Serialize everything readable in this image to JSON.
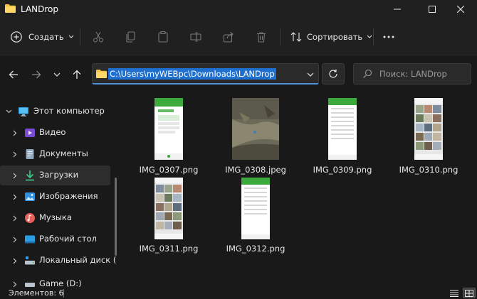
{
  "window": {
    "title": "LANDrop"
  },
  "toolbar": {
    "create_label": "Создать",
    "sort_label": "Сортировать",
    "icons": [
      "cut-icon",
      "copy-icon",
      "paste-icon",
      "rename-icon",
      "share-icon",
      "delete-icon"
    ]
  },
  "address": {
    "path": "C:\\Users\\myWEBpc\\Downloads\\LANDrop"
  },
  "search": {
    "placeholder": "Поиск: LANDrop"
  },
  "sidebar": {
    "items": [
      {
        "label": "Этот компьютер",
        "icon": "monitor-icon",
        "expanded": true
      },
      {
        "label": "Видео",
        "icon": "video-icon"
      },
      {
        "label": "Документы",
        "icon": "document-icon"
      },
      {
        "label": "Загрузки",
        "icon": "download-icon",
        "selected": true
      },
      {
        "label": "Изображения",
        "icon": "image-icon"
      },
      {
        "label": "Музыка",
        "icon": "music-icon"
      },
      {
        "label": "Рабочий стол",
        "icon": "desktop-icon"
      },
      {
        "label": "Локальный диск (C",
        "icon": "drive-icon"
      },
      {
        "label": "Game (D:)",
        "icon": "drive-icon"
      }
    ]
  },
  "files": [
    {
      "name": "IMG_0307.png",
      "kind": "phone-green-screenshot"
    },
    {
      "name": "IMG_0308.jpeg",
      "kind": "photo"
    },
    {
      "name": "IMG_0309.png",
      "kind": "phone-list-screenshot"
    },
    {
      "name": "IMG_0310.png",
      "kind": "phone-gallery-screenshot"
    },
    {
      "name": "IMG_0311.png",
      "kind": "phone-gallery-screenshot"
    },
    {
      "name": "IMG_0312.png",
      "kind": "phone-list-screenshot"
    }
  ],
  "status": {
    "count_text": "Элементов: 6"
  },
  "colors": {
    "accent": "#1f6fcf",
    "folder": "#f6c445",
    "app_green": "#3daa3d"
  }
}
